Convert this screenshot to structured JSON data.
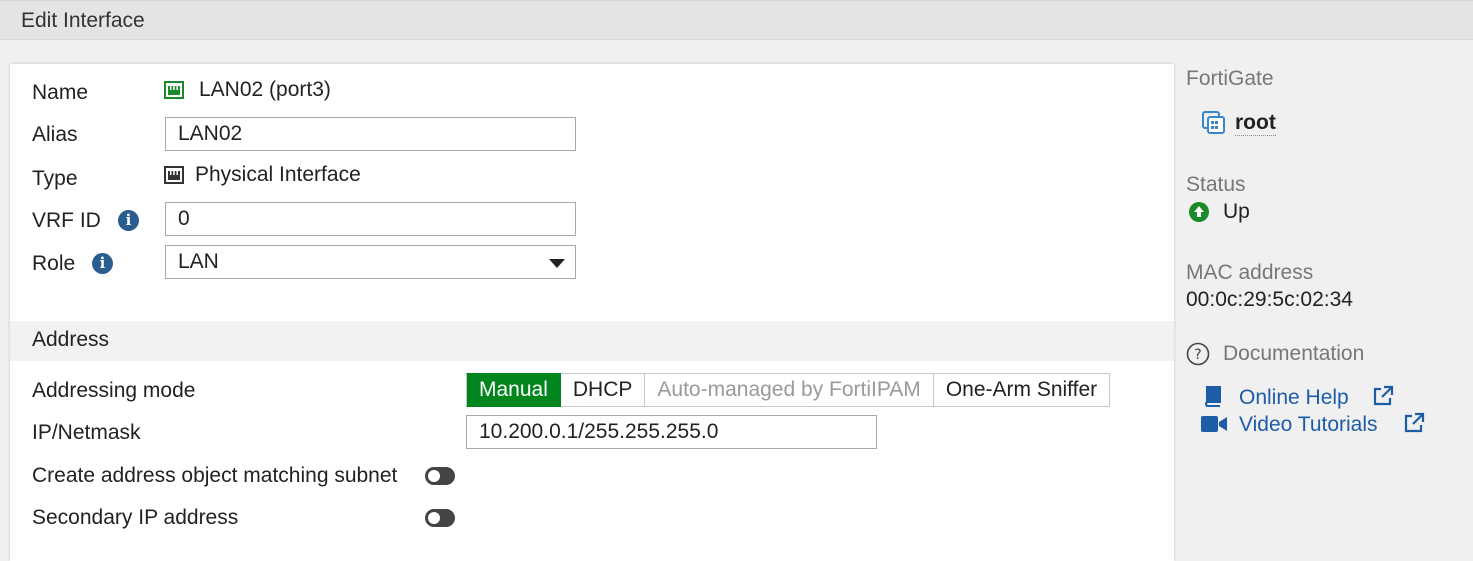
{
  "header": {
    "title": "Edit Interface"
  },
  "form": {
    "name": {
      "label": "Name",
      "value": "LAN02 (port3)"
    },
    "alias": {
      "label": "Alias",
      "value": "LAN02"
    },
    "type": {
      "label": "Type",
      "value": "Physical Interface"
    },
    "vrf": {
      "label": "VRF ID",
      "value": "0"
    },
    "role": {
      "label": "Role",
      "value": "LAN"
    }
  },
  "address": {
    "section_title": "Address",
    "mode_label": "Addressing mode",
    "modes": [
      "Manual",
      "DHCP",
      "Auto-managed by FortiIPAM",
      "One-Arm Sniffer"
    ],
    "selected_mode": "Manual",
    "ip_label": "IP/Netmask",
    "ip_value": "10.200.0.1/255.255.255.0",
    "create_obj_label": "Create address object matching subnet",
    "create_obj_enabled": false,
    "secondary_label": "Secondary IP address",
    "secondary_enabled": false
  },
  "sidebar": {
    "fortigate_label": "FortiGate",
    "vdom": "root",
    "status_label": "Status",
    "status_value": "Up",
    "mac_label": "MAC address",
    "mac_value": "00:0c:29:5c:02:34",
    "doc_label": "Documentation",
    "links": [
      "Online Help",
      "Video Tutorials"
    ]
  },
  "colors": {
    "accent_green": "#00861d",
    "link_blue": "#1d5ca8",
    "info_blue": "#2a5d8f"
  }
}
